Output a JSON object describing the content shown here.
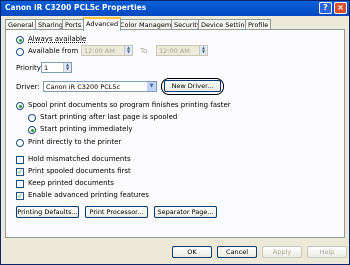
{
  "window": {
    "title": "Canon iR C3200 PCL5c Properties",
    "help_glyph": "?",
    "close_glyph": "×"
  },
  "tabs": [
    {
      "label": "General"
    },
    {
      "label": "Sharing"
    },
    {
      "label": "Ports"
    },
    {
      "label": "Advanced"
    },
    {
      "label": "Color Management"
    },
    {
      "label": "Security"
    },
    {
      "label": "Device Settings"
    },
    {
      "label": "Profile"
    }
  ],
  "availability": {
    "always_label": "Always available",
    "from_label": "Available from",
    "from_time": "12:00 AM",
    "to_label": "To",
    "to_time": "12:00 AM"
  },
  "priority": {
    "label": "Priority:",
    "value": "1"
  },
  "driver": {
    "label": "Driver:",
    "value": "Canon iR C3200 PCL5c",
    "new_driver_button": "New Driver..."
  },
  "spooling": {
    "spool_label": "Spool print documents so program finishes printing faster",
    "after_last_page_label": "Start printing after last page is spooled",
    "immediately_label": "Start printing immediately",
    "direct_label": "Print directly to the printer"
  },
  "options": {
    "hold_mismatched": "Hold mismatched documents",
    "spooled_first": "Print spooled documents first",
    "keep_printed": "Keep printed documents",
    "advanced_features": "Enable advanced printing features",
    "check_glyph": "✓"
  },
  "buttons": {
    "printing_defaults": "Printing Defaults...",
    "print_processor": "Print Processor...",
    "separator_page": "Separator Page...",
    "ok": "OK",
    "cancel": "Cancel",
    "apply": "Apply",
    "help": "Help"
  }
}
